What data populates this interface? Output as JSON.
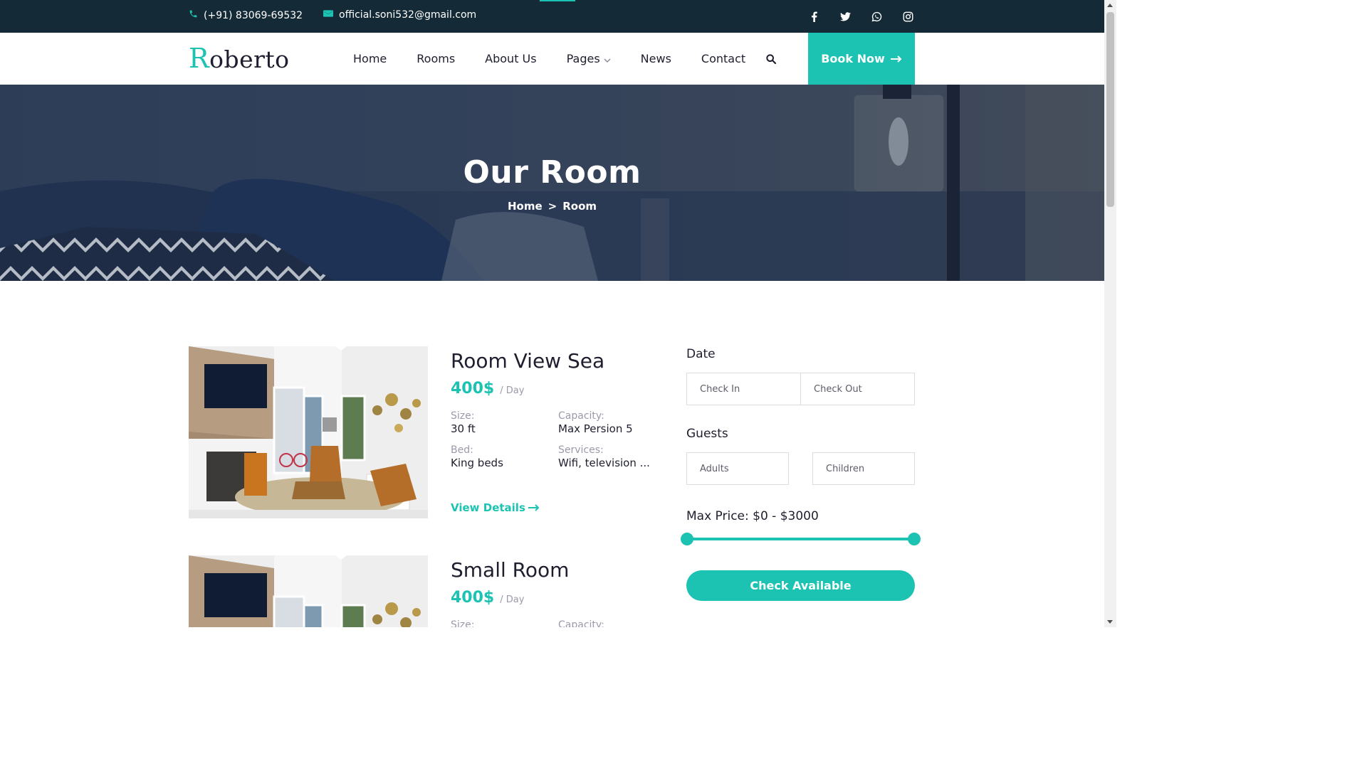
{
  "topbar": {
    "phone": "(+91) 83069-69532",
    "email": "official.soni532@gmail.com",
    "socials": [
      "facebook-icon",
      "twitter-icon",
      "whatsapp-icon",
      "instagram-icon"
    ]
  },
  "header": {
    "logo_initial": "R",
    "logo_rest": "oberto",
    "nav": [
      "Home",
      "Rooms",
      "About Us",
      "Pages",
      "News",
      "Contact"
    ],
    "book_label": "Book Now"
  },
  "hero": {
    "title": "Our Room",
    "breadcrumb_home": "Home",
    "breadcrumb_separator": ">",
    "breadcrumb_current": "Room"
  },
  "rooms": [
    {
      "name": "Room View Sea",
      "price": "400$",
      "per": "/ Day",
      "size_label": "Size:",
      "size": "30 ft",
      "capacity_label": "Capacity:",
      "capacity": "Max Persion 5",
      "bed_label": "Bed:",
      "bed": "King beds",
      "services_label": "Services:",
      "services": "Wifi, television ...",
      "link": "View Details"
    },
    {
      "name": "Small Room",
      "price": "400$",
      "per": "/ Day",
      "size_label": "Size:",
      "capacity_label": "Capacity:"
    }
  ],
  "search_form": {
    "date_label": "Date",
    "check_in_placeholder": "Check In",
    "check_out_placeholder": "Check Out",
    "guests_label": "Guests",
    "adults_placeholder": "Adults",
    "children_placeholder": "Children",
    "price_label": "Max Price: $0 - $3000",
    "price_min": 0,
    "price_max": 3000,
    "submit_label": "Check Available"
  },
  "colors": {
    "accent": "#1cc3b2",
    "topbar": "#142a36",
    "text": "#1e1e2f",
    "muted": "#9a9aaa"
  }
}
